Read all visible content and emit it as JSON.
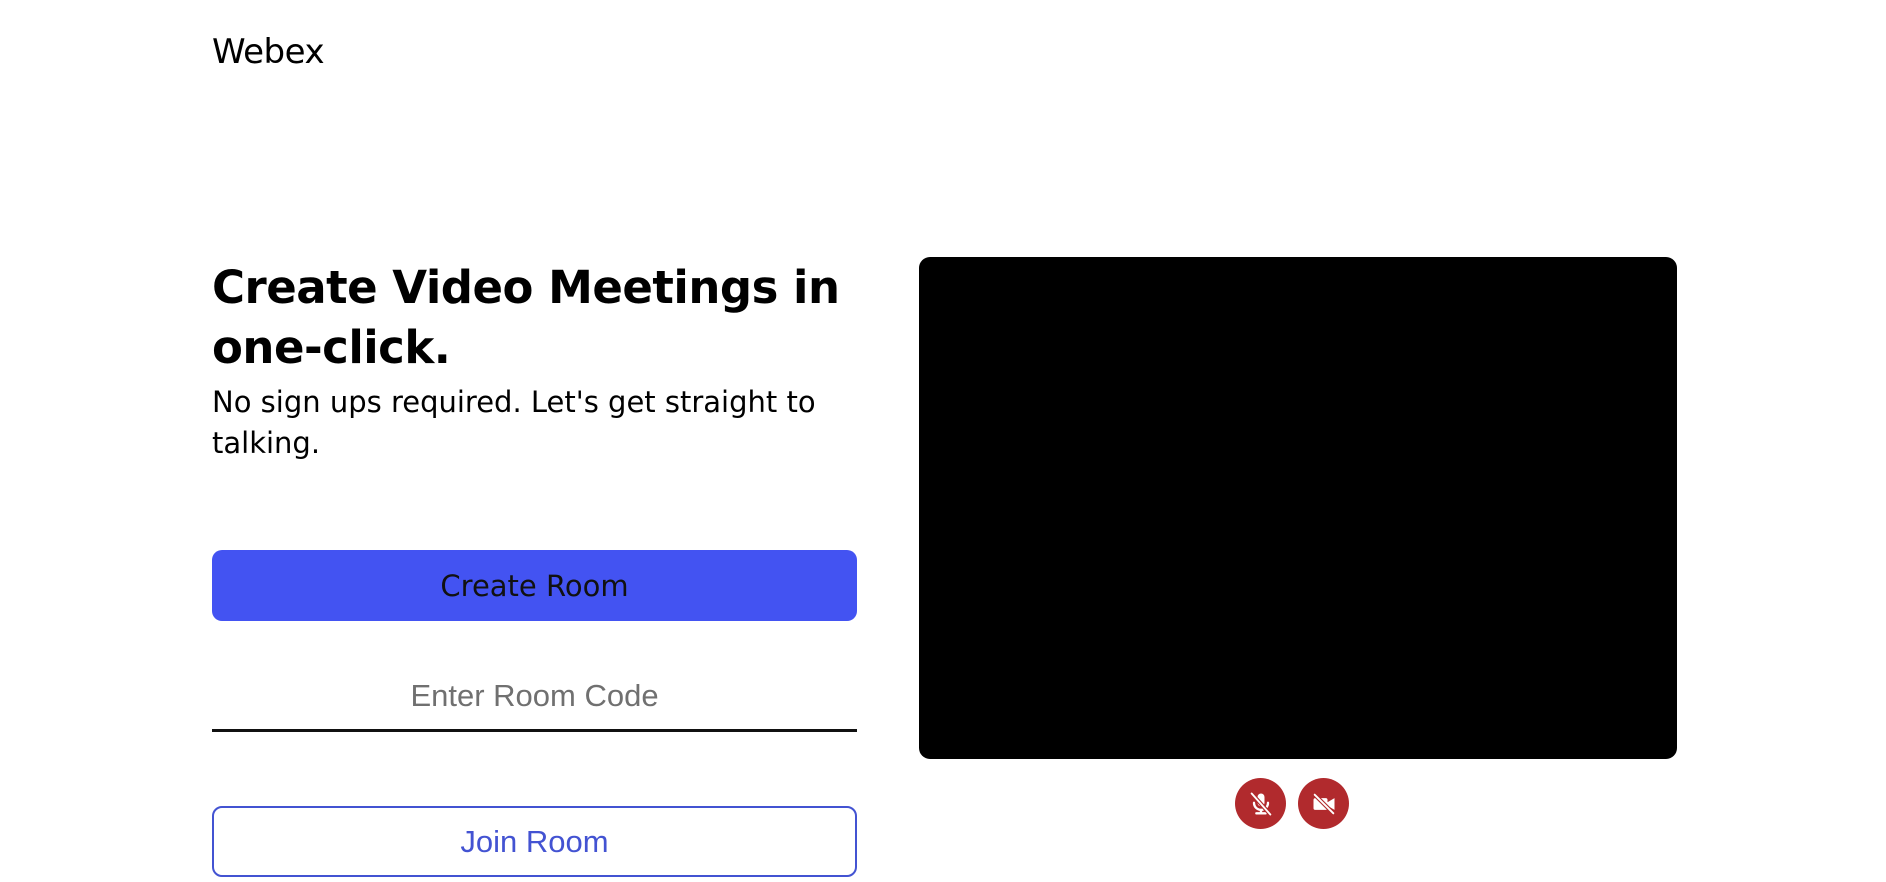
{
  "header": {
    "logo_text": "Webex"
  },
  "hero": {
    "headline": "Create Video Meetings in one-click.",
    "subhead": "No sign ups required. Let's get straight to talking."
  },
  "actions": {
    "create_room_label": "Create Room",
    "room_code_placeholder": "Enter Room Code",
    "room_code_value": "",
    "join_room_label": "Join Room"
  },
  "media_controls": {
    "mic_icon": "mic-off-icon",
    "camera_icon": "camera-off-icon"
  },
  "colors": {
    "primary": "#4353f2",
    "join_text": "#4353d2",
    "control_bg": "#b12a2d",
    "video_bg": "#000000"
  }
}
